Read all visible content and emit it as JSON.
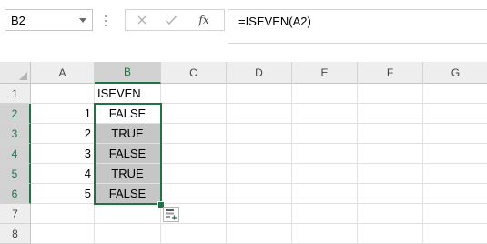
{
  "name_box": {
    "value": "B2"
  },
  "formula_bar": {
    "cancel_icon": "close-icon",
    "enter_icon": "check-icon",
    "fx_label": "fx",
    "formula": "=ISEVEN(A2)"
  },
  "columns": [
    "A",
    "B",
    "C",
    "D",
    "E",
    "F",
    "G"
  ],
  "selected_column": "B",
  "rows": [
    "1",
    "2",
    "3",
    "4",
    "5",
    "6",
    "7",
    "8"
  ],
  "cells": {
    "A2": "1",
    "A3": "2",
    "A4": "3",
    "A5": "4",
    "A6": "5",
    "B1": "ISEVEN",
    "B2": "FALSE",
    "B3": "TRUE",
    "B4": "FALSE",
    "B5": "TRUE",
    "B6": "FALSE"
  },
  "colors": {
    "accent": "#217346",
    "selected_range_fill": "#c6c6c6",
    "header_fill": "#eeeeee"
  },
  "quick_analysis_icon": "quick-analysis-icon"
}
